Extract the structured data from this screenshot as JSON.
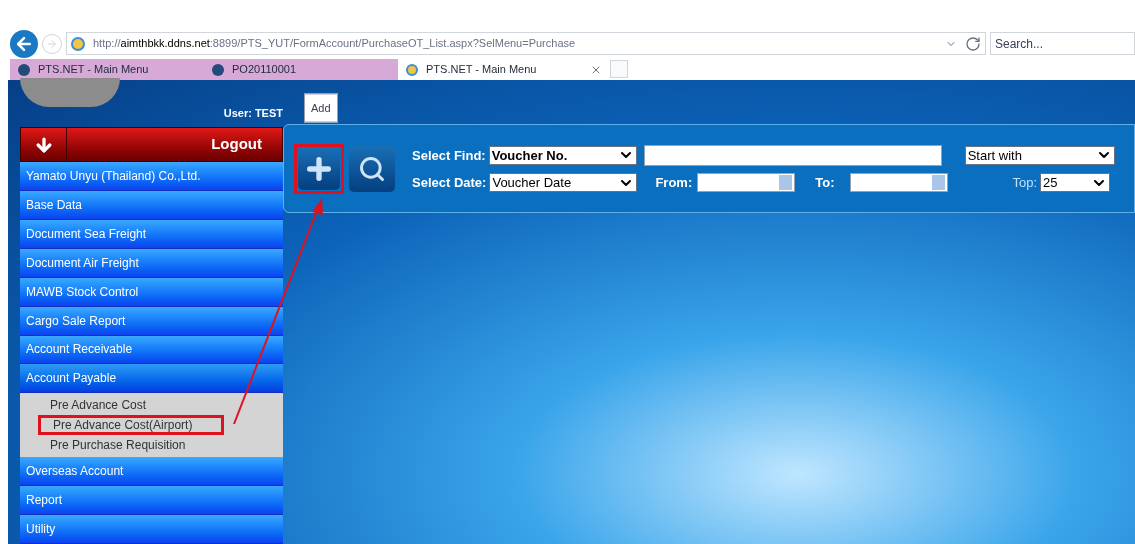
{
  "browser": {
    "url": "http://**aimthbkk.ddns.net**:8899/PTS_YUT/FormAccount/PurchaseOT_List.aspx?SelMenu=Purchase",
    "search_placeholder": "Search...",
    "tabs": [
      {
        "title": "PTS.NET - Main Menu",
        "selected": false,
        "kind": "app"
      },
      {
        "title": "PO20110001",
        "selected": false,
        "kind": "app"
      },
      {
        "title": "PTS.NET - Main Menu",
        "selected": true,
        "kind": "ie"
      }
    ]
  },
  "sidebar": {
    "user": "User: TEST",
    "logout": "Logout",
    "items": [
      {
        "label": "Yamato Unyu (Thailand) Co.,Ltd.",
        "expanded": false
      },
      {
        "label": "Base Data",
        "expanded": false
      },
      {
        "label": "Document Sea Freight",
        "expanded": false
      },
      {
        "label": "Document Air Freight",
        "expanded": false
      },
      {
        "label": "MAWB Stock Control",
        "expanded": false
      },
      {
        "label": "Cargo Sale Report",
        "expanded": false
      },
      {
        "label": "Account Receivable",
        "expanded": false
      },
      {
        "label": "Account Payable",
        "expanded": true,
        "children": [
          {
            "label": "Pre Advance Cost",
            "highlighted": false
          },
          {
            "label": "Pre Advance Cost(Airport)",
            "highlighted": true
          },
          {
            "label": "Pre Purchase Requisition",
            "highlighted": false
          }
        ]
      },
      {
        "label": "Overseas Account",
        "expanded": false
      },
      {
        "label": "Report",
        "expanded": false
      },
      {
        "label": "Utility",
        "expanded": false
      }
    ]
  },
  "toolbar": {
    "add_tooltip": "Add",
    "add_highlighted": true,
    "find_label": "Select Find:",
    "find_value": "Voucher No.",
    "match_value": "Start with",
    "date_label": "Select Date:",
    "date_value": "Voucher Date",
    "from_label": "From:",
    "to_label": "To:",
    "top_label": "Top:",
    "top_value": "25"
  }
}
